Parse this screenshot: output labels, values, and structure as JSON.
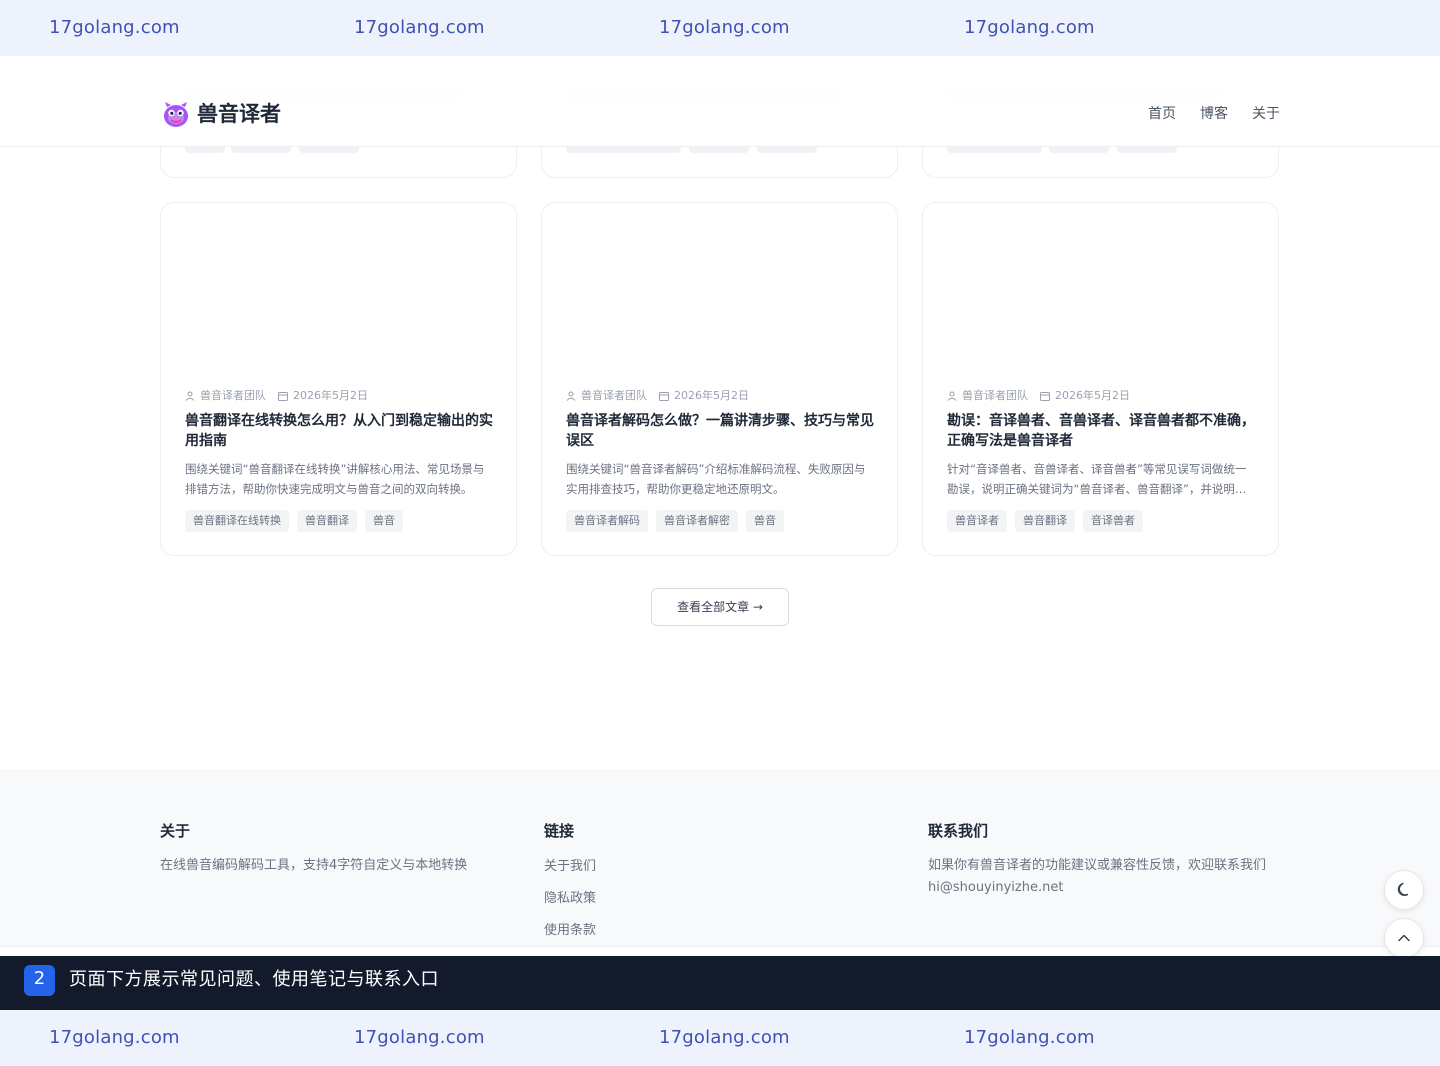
{
  "watermark": {
    "text": "17golang.com"
  },
  "header": {
    "brand": "兽音译者",
    "nav": [
      "首页",
      "博客",
      "关于"
    ]
  },
  "cards": [
    {
      "author": "兽音译者团队",
      "date": "2026年5月2日",
      "title": "兽音翻译在线转换怎么用？从入门到稳定输出的实用指南",
      "excerpt": "围绕关键词“兽音翻译在线转换”讲解核心用法、常见场景与排错方法，帮助你快速完成明文与兽音之间的双向转换。",
      "tags": [
        "兽音翻译在线转换",
        "兽音翻译",
        "兽音"
      ]
    },
    {
      "author": "兽音译者团队",
      "date": "2026年5月2日",
      "title": "兽音译者解码怎么做？一篇讲清步骤、技巧与常见误区",
      "excerpt": "围绕关键词“兽音译者解码”介绍标准解码流程、失败原因与实用排查技巧，帮助你更稳定地还原明文。",
      "tags": [
        "兽音译者解码",
        "兽音译者解密",
        "兽音"
      ]
    },
    {
      "author": "兽音译者团队",
      "date": "2026年5月2日",
      "title": "勘误：音译兽者、音兽译者、译音兽者都不准确，正确写法是兽音译者",
      "excerpt": "针对“音译兽者、音兽译者、译音兽者”等常见误写词做统一勘误，说明正确关键词为“兽音译者、兽音翻译”，并说明来源。",
      "tags": [
        "兽音译者",
        "兽音翻译",
        "音译兽者"
      ]
    }
  ],
  "view_all": "查看全部文章 →",
  "footer": {
    "about": {
      "heading": "关于",
      "text": "在线兽音编码解码工具，支持4字符自定义与本地转换"
    },
    "links": {
      "heading": "链接",
      "items": [
        "关于我们",
        "隐私政策",
        "使用条款"
      ]
    },
    "contact": {
      "heading": "联系我们",
      "text": "如果你有兽音译者的功能建议或兼容性反馈，欢迎联系我们hi@shouyinyizhe.net"
    }
  },
  "banner": {
    "step": "2",
    "text": "页面下方展示常见问题、使用笔记与联系入口"
  },
  "colors": {
    "accent": "#2563eb",
    "banner_bg": "#131a2c",
    "watermark": "#3f51b5"
  }
}
